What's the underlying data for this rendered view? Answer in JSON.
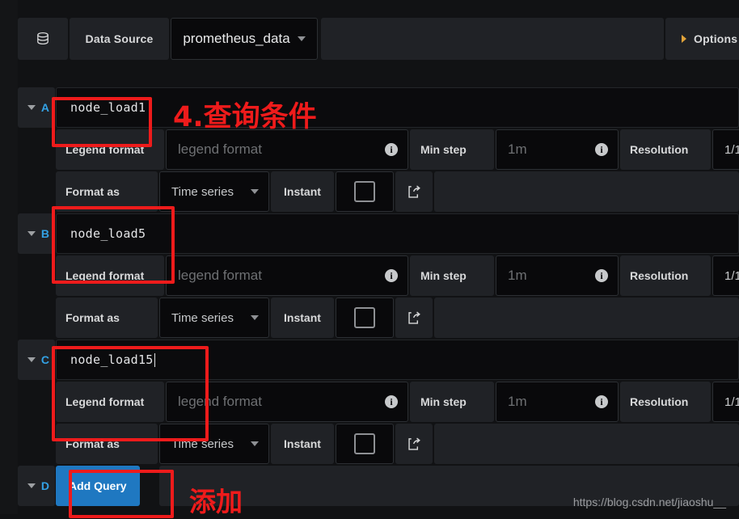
{
  "datasource_bar": {
    "icon": "database-icon",
    "label": "Data Source",
    "selected": "prometheus_data",
    "options_label": "Options"
  },
  "common": {
    "legend_label": "Legend format",
    "legend_placeholder": "legend format",
    "min_step_label": "Min step",
    "min_step_placeholder": "1m",
    "resolution_label": "Resolution",
    "resolution_value": "1/1",
    "format_as_label": "Format as",
    "format_as_value": "Time series",
    "instant_label": "Instant",
    "info_glyph": "i",
    "share_icon": "share-external-icon",
    "collapse_icon": "chevron-down-icon",
    "dropdown_icon": "chevron-down-icon"
  },
  "queries": [
    {
      "letter": "A",
      "expression": "node_load1",
      "cursor": false
    },
    {
      "letter": "B",
      "expression": "node_load5",
      "cursor": false
    },
    {
      "letter": "C",
      "expression": "node_load15",
      "cursor": true
    }
  ],
  "add_query_row": {
    "letter": "D",
    "button_label": "Add Query"
  },
  "annotations": {
    "title": "4.查询条件",
    "add": "添加",
    "color": "#ee1b1b"
  },
  "watermark": "https://blog.csdn.net/jiaoshu__",
  "colors": {
    "accent_blue": "#33a2e5",
    "button_blue": "#1f78c1",
    "options_caret": "#e0a33a",
    "panel": "#202226",
    "field": "#09090b",
    "page_bg": "#111214"
  }
}
